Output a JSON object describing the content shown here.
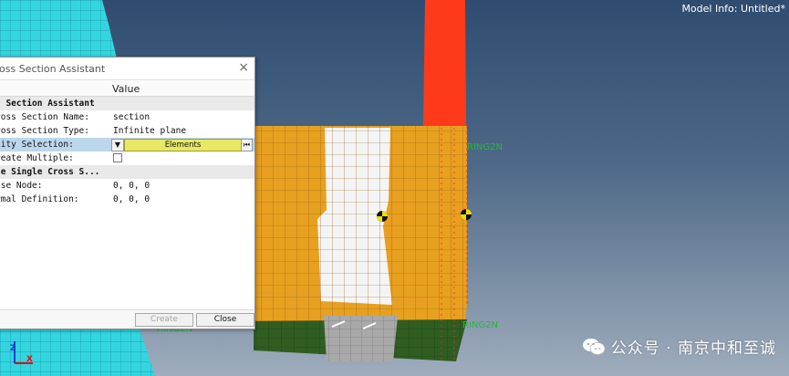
{
  "viewport": {
    "model_info": "Model Info: Untitled*",
    "spring_labels": [
      "RING2N",
      "RING2N",
      "RING2N"
    ],
    "axis": {
      "z": "Z",
      "x": "X"
    }
  },
  "dialog": {
    "title": "oss Section Assistant",
    "close_glyph": "×",
    "column_header": "Value",
    "rows": [
      {
        "label": "s Section Assistant",
        "value": "",
        "type": "section"
      },
      {
        "label": "ross Section Name:",
        "value": "section",
        "type": "row"
      },
      {
        "label": "ross Section Type:",
        "value": "Infinite plane",
        "type": "row"
      },
      {
        "label": "tity Selection:",
        "value": "Elements",
        "type": "selection"
      },
      {
        "label": "reate Multiple:",
        "value": "",
        "type": "checkbox"
      },
      {
        "label": "te Single Cross S...",
        "value": "",
        "type": "section"
      },
      {
        "label": "ase Node:",
        "value": "0, 0, 0",
        "type": "row"
      },
      {
        "label": "rmal Definition:",
        "value": "0, 0, 0",
        "type": "row"
      }
    ],
    "dropdown_glyph": "▼",
    "reset_glyph": "⏮",
    "buttons": {
      "create": "Create",
      "close": "Close"
    }
  },
  "watermark": {
    "text": "公众号 · 南京中和至诚",
    "icon": "wechat-icon"
  },
  "colors": {
    "element_orange": "#e8a020",
    "element_white": "#f2f2f2",
    "element_green": "#2e5c22",
    "element_red": "#ff3a1a",
    "element_cyan": "#2ed3df",
    "selection_yellow": "#e8e864"
  }
}
